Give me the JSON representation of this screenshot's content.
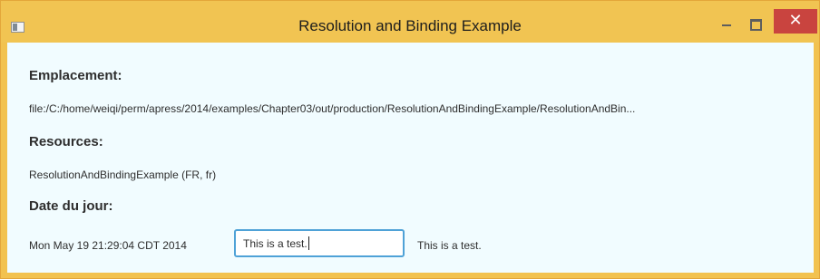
{
  "window": {
    "title": "Resolution and Binding Example",
    "close_label": "✕"
  },
  "fields": {
    "emplacement_label": "Emplacement:",
    "emplacement_value": "file:/C:/home/weiqi/perm/apress/2014/examples/Chapter03/out/production/ResolutionAndBindingExample/ResolutionAndBin...",
    "resources_label": "Resources:",
    "resources_value": "ResolutionAndBindingExample (FR, fr)",
    "date_label": "Date du jour:",
    "date_value": "Mon May 19 21:29:04 CDT 2014",
    "input_value": "This is a test.",
    "bound_text": "This is a test."
  },
  "colors": {
    "titlebar": "#f1c452",
    "content_background": "#f1fcff",
    "close_button": "#c9443f",
    "input_border": "#4fa2d7"
  },
  "icons": {
    "app_icon": "window-icon",
    "minimize_icon": "minimize-icon",
    "maximize_icon": "maximize-icon",
    "close_icon": "close-icon"
  }
}
